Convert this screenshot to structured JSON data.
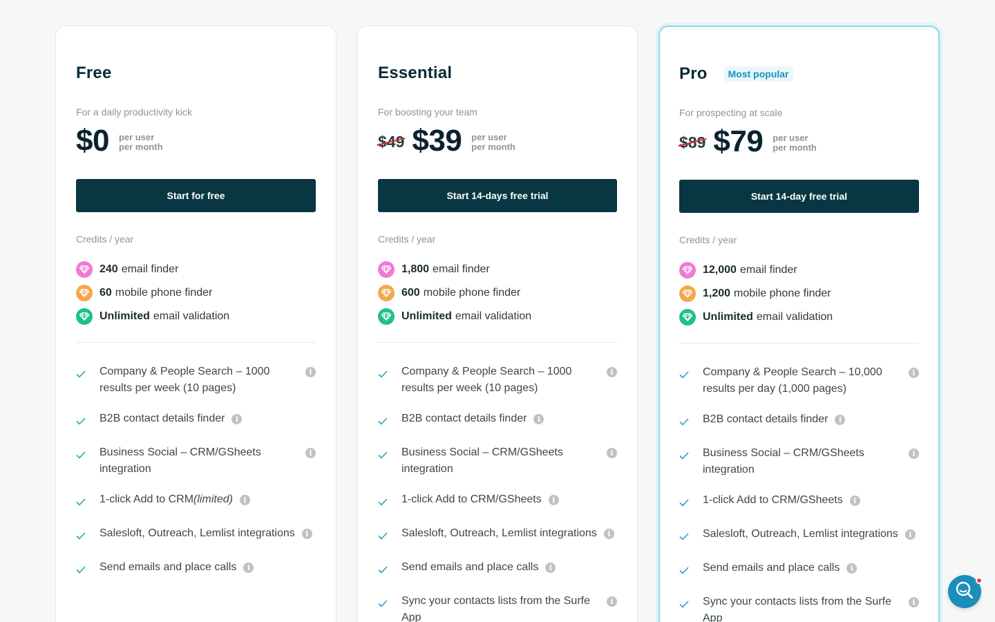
{
  "colors": {
    "button_bg": "#083642",
    "accent": "#1794b8",
    "check": "#2a9fc0",
    "strike": "#d72b2b",
    "gem_pink": "#f07ad4",
    "gem_orange": "#f3a84a",
    "gem_green": "#1fbf8f"
  },
  "plans": [
    {
      "name": "Free",
      "badge": "",
      "tagline": "For a daily productivity kick",
      "old_price": "",
      "price": "$0",
      "per_user": "per user",
      "per_month": "per month",
      "cta": "Start for free",
      "credits_label": "Credits / year",
      "credits": [
        {
          "amount": "240",
          "label": "email finder",
          "icon": "pink-gem-icon"
        },
        {
          "amount": "60",
          "label": "mobile phone finder",
          "icon": "orange-gem-icon"
        },
        {
          "amount": "Unlimited",
          "label": "email validation",
          "icon": "green-gem-icon"
        }
      ],
      "features": [
        {
          "text": "Company & People Search – 1000 results per week (10 pages)"
        },
        {
          "text": "B2B contact details finder"
        },
        {
          "text": "Business Social – CRM/GSheets integration"
        },
        {
          "text": "1-click Add to CRM",
          "italic": "(limited)"
        },
        {
          "text": "Salesloft, Outreach, Lemlist integrations"
        },
        {
          "text": "Send emails and place calls"
        }
      ]
    },
    {
      "name": "Essential",
      "badge": "",
      "tagline": "For boosting your team",
      "old_price": "$49",
      "price": "$39",
      "per_user": "per user",
      "per_month": "per month",
      "cta": "Start 14-days free trial",
      "credits_label": "Credits / year",
      "credits": [
        {
          "amount": "1,800",
          "label": "email finder",
          "icon": "pink-gem-icon"
        },
        {
          "amount": "600",
          "label": "mobile phone finder",
          "icon": "orange-gem-icon"
        },
        {
          "amount": "Unlimited",
          "label": "email validation",
          "icon": "green-gem-icon"
        }
      ],
      "features": [
        {
          "text": "Company & People Search – 1000 results per week (10 pages)"
        },
        {
          "text": "B2B contact details finder"
        },
        {
          "text": "Business Social – CRM/GSheets integration"
        },
        {
          "text": "1-click Add to CRM/GSheets"
        },
        {
          "text": "Salesloft, Outreach, Lemlist integrations"
        },
        {
          "text": "Send emails and place calls"
        },
        {
          "text": "Sync your contacts lists from the Surfe App"
        }
      ]
    },
    {
      "name": "Pro",
      "badge": "Most popular",
      "tagline": "For prospecting at scale",
      "old_price": "$89",
      "price": "$79",
      "per_user": "per user",
      "per_month": "per month",
      "cta": "Start 14-day free trial",
      "credits_label": "Credits / year",
      "credits": [
        {
          "amount": "12,000",
          "label": "email finder",
          "icon": "pink-gem-icon"
        },
        {
          "amount": "1,200",
          "label": "mobile phone finder",
          "icon": "orange-gem-icon"
        },
        {
          "amount": "Unlimited",
          "label": "email validation",
          "icon": "green-gem-icon"
        }
      ],
      "features": [
        {
          "text": "Company & People Search – 10,000 results per day (1,000 pages)"
        },
        {
          "text": "B2B contact details finder"
        },
        {
          "text": "Business Social – CRM/GSheets integration"
        },
        {
          "text": "1-click Add to CRM/GSheets"
        },
        {
          "text": "Salesloft, Outreach, Lemlist integrations"
        },
        {
          "text": "Send emails and place calls"
        },
        {
          "text": "Sync your contacts lists from the Surfe App"
        }
      ]
    }
  ],
  "chat": {
    "icon": "chat-search-icon"
  }
}
